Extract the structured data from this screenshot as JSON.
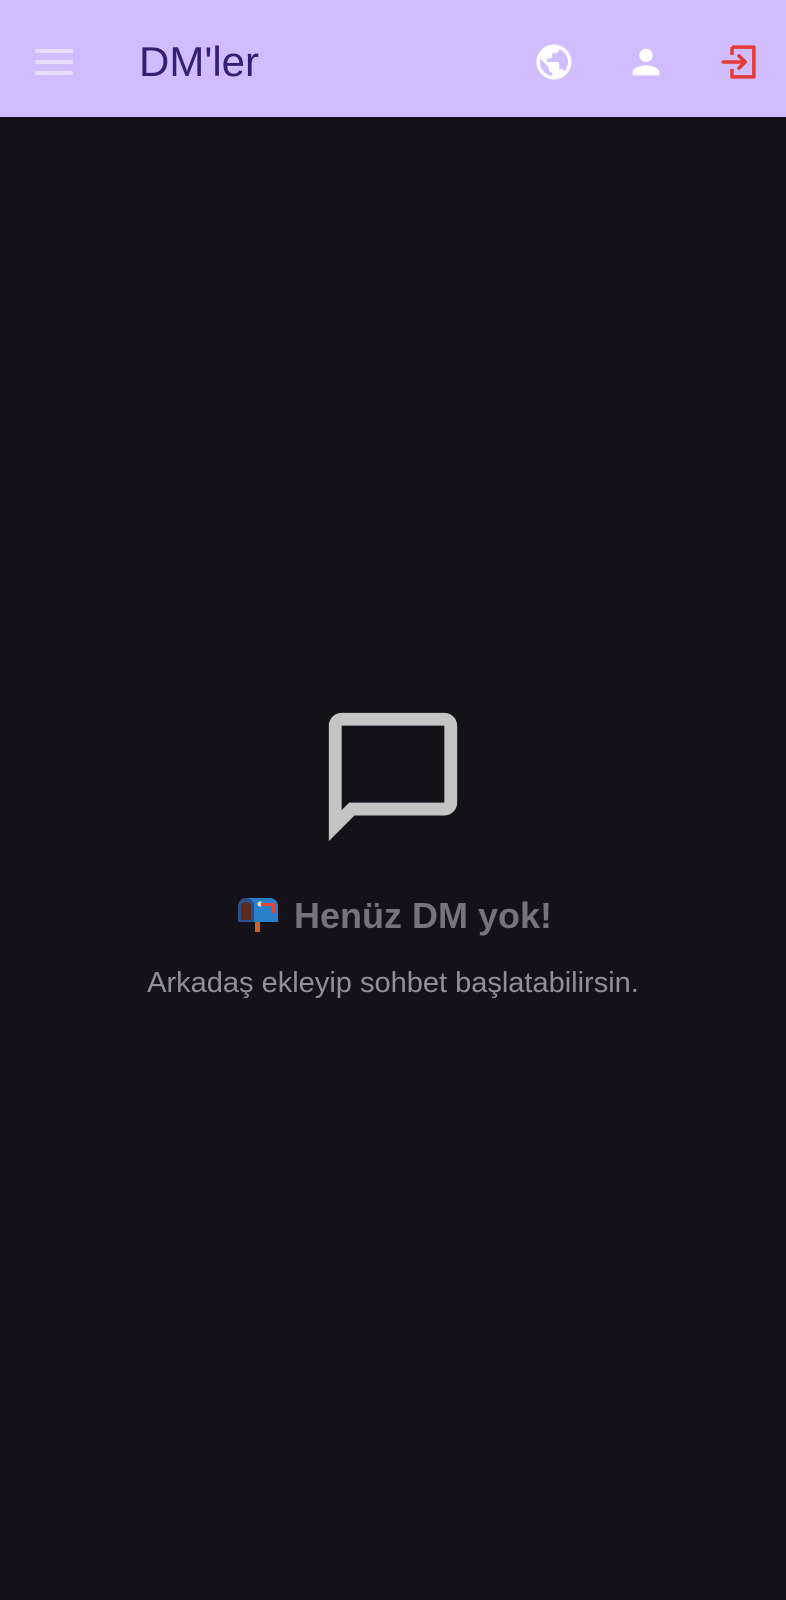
{
  "appbar": {
    "title": "DM'ler",
    "background_color": "#d0bcff",
    "title_color": "#381e72",
    "menu_icon": "menu-icon",
    "actions": [
      {
        "icon": "globe-icon",
        "color": "#ffffff"
      },
      {
        "icon": "person-icon",
        "color": "#ffffff"
      },
      {
        "icon": "logout-icon",
        "color": "#e53935"
      }
    ]
  },
  "empty_state": {
    "icon": "chat-bubble-outline-icon",
    "emoji": "📭",
    "title": "Henüz DM yok!",
    "subtitle": "Arkadaş ekleyip sohbet başlatabilirsin."
  },
  "colors": {
    "background": "#141218",
    "empty_title": "#77737c",
    "empty_subtitle": "#938f99",
    "empty_icon": "#c4c4c4"
  }
}
